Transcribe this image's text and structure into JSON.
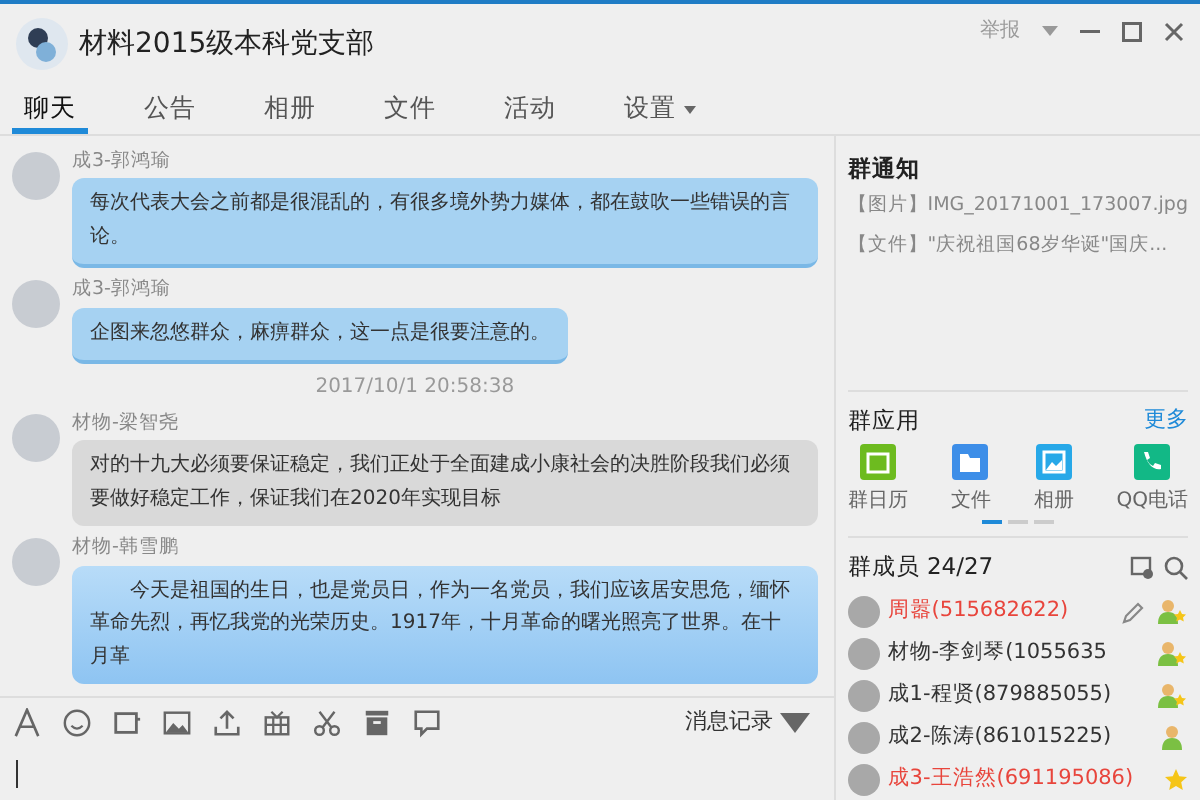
{
  "window": {
    "title": "材料2015级本科党支部",
    "report": "举报"
  },
  "tabs": [
    {
      "label": "聊天",
      "selected": true,
      "dropdown": false
    },
    {
      "label": "公告",
      "selected": false,
      "dropdown": false
    },
    {
      "label": "相册",
      "selected": false,
      "dropdown": false
    },
    {
      "label": "文件",
      "selected": false,
      "dropdown": false
    },
    {
      "label": "活动",
      "selected": false,
      "dropdown": false
    },
    {
      "label": "设置",
      "selected": false,
      "dropdown": true
    }
  ],
  "messages": [
    {
      "kind": "blue",
      "sender": "成3-郭鸿瑜",
      "text": "每次代表大会之前都是很混乱的，有很多境外势力媒体，都在鼓吹一些错误的言论。"
    },
    {
      "kind": "blue",
      "sender": "成3-郭鸿瑜",
      "text": "企图来忽悠群众，麻痹群众，这一点是很要注意的。"
    },
    {
      "kind": "time",
      "text": "2017/10/1 20:58:38"
    },
    {
      "kind": "grey",
      "sender": "材物-梁智尧",
      "text": "对的十九大必须要保证稳定，我们正处于全面建成小康社会的决胜阶段我们必须要做好稳定工作，保证我们在2020年实现目标"
    },
    {
      "kind": "gradient",
      "sender": "材物-韩雪鹏",
      "text": "今天是祖国的生日，也是党员日，作为一名党员，我们应该居安思危，缅怀革命先烈，再忆我党的光荣历史。1917年，十月革命的曙光照亮了世界。在十月革"
    }
  ],
  "history_button": "消息记录",
  "notice": {
    "title": "群通知",
    "items": [
      {
        "tag": "【图片】",
        "text": "IMG_20171001_173007.jpg"
      },
      {
        "tag": "【文件】",
        "text": "\"庆祝祖国68岁华诞\"国庆..."
      }
    ]
  },
  "apps": {
    "title": "群应用",
    "more": "更多",
    "items": [
      {
        "kind": "calendar",
        "label": "群日历",
        "color": "#6dbb1f"
      },
      {
        "kind": "file",
        "label": "文件",
        "color": "#3d8ee8"
      },
      {
        "kind": "album",
        "label": "相册",
        "color": "#27a8e8"
      },
      {
        "kind": "phone",
        "label": "QQ电话",
        "color": "#12b886"
      }
    ]
  },
  "members": {
    "title": "群成员 24/27",
    "items": [
      {
        "name": "周嚣(515682622)",
        "color": "#e8453c",
        "kind": "owner"
      },
      {
        "name": "材物-李剑琴(1055635",
        "color": "#333333",
        "kind": "admin"
      },
      {
        "name": "成1-程贤(879885055)",
        "color": "#333333",
        "kind": "admin"
      },
      {
        "name": "成2-陈涛(861015225)",
        "color": "#333333",
        "kind": "member"
      },
      {
        "name": "成3-王浩然(691195086)",
        "color": "#e8453c",
        "kind": "star"
      }
    ]
  }
}
